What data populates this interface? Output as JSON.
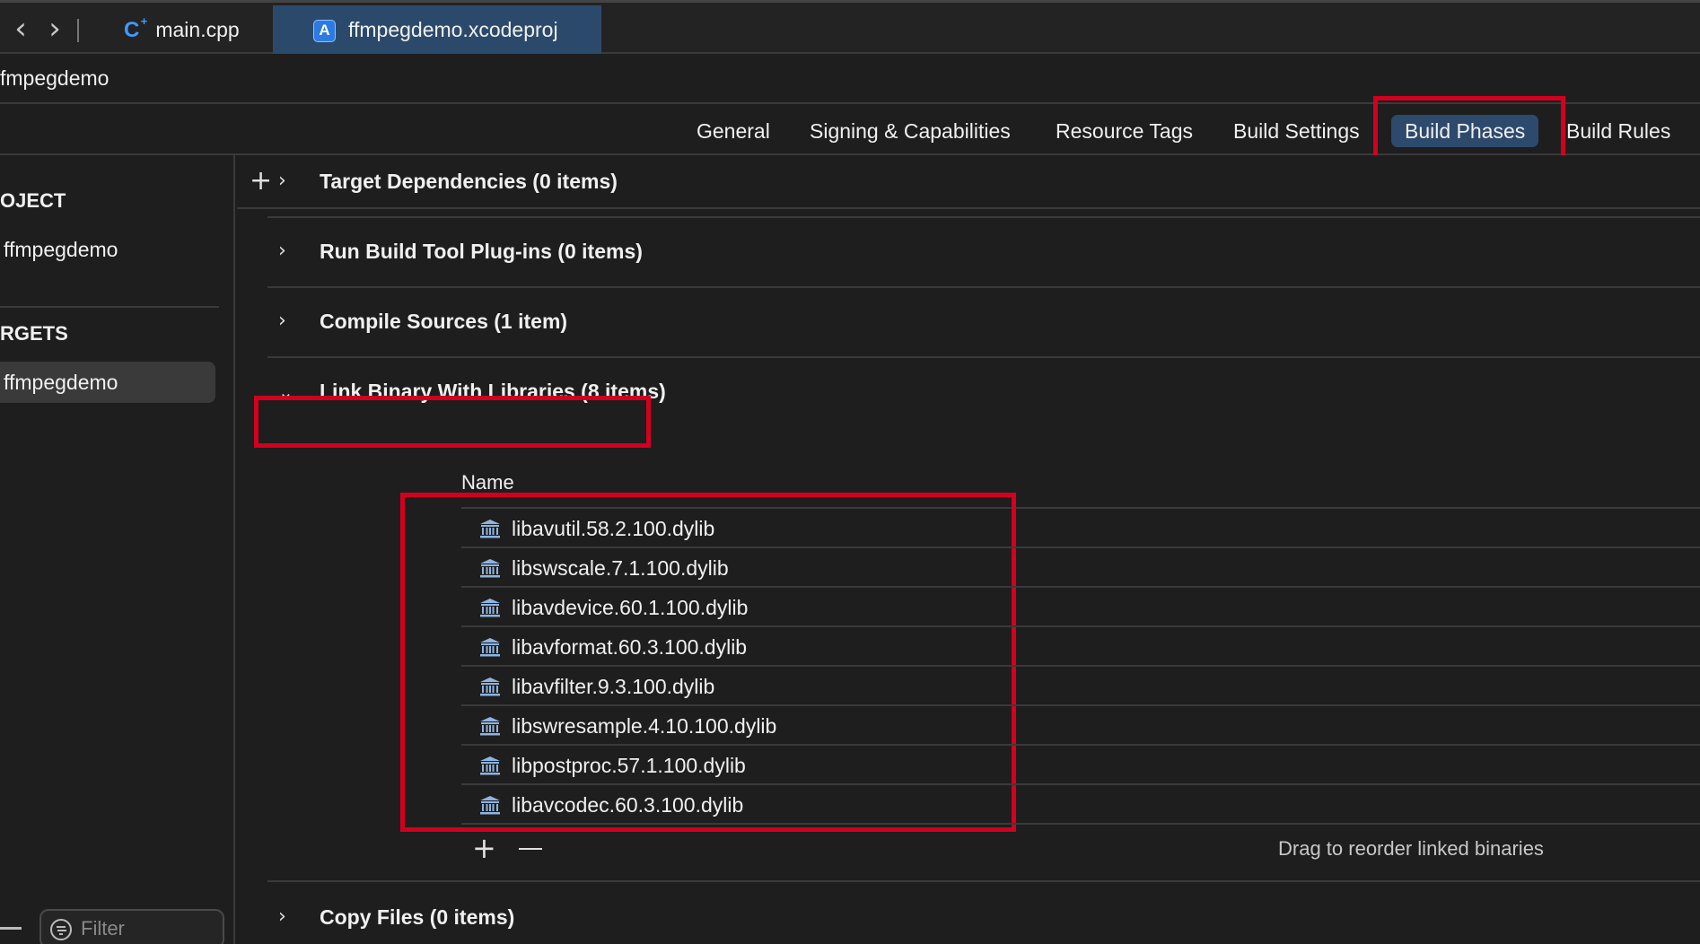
{
  "tabs": {
    "main_cpp": {
      "label": "main.cpp",
      "icon": "c-plus-plus-file-icon",
      "icon_text": "C",
      "icon_sup": "+"
    },
    "project": {
      "label": "ffmpegdemo.xcodeproj",
      "icon": "xcode-project-icon"
    }
  },
  "breadcrumb": {
    "label": "fmpegdemo"
  },
  "editor_tabs": {
    "general": "General",
    "signing": "Signing & Capabilities",
    "resource_tags": "Resource Tags",
    "build_settings": "Build Settings",
    "build_phases": "Build Phases",
    "build_rules": "Build Rules",
    "selected": "Build Phases"
  },
  "sidebar": {
    "project_header": "OJECT",
    "project_item": "ffmpegdemo",
    "targets_header": "RGETS",
    "target_item": "ffmpegdemo",
    "filter_placeholder": "Filter"
  },
  "phases": {
    "add_symbol": "+",
    "target_dependencies": "Target Dependencies (0 items)",
    "run_build_tool": "Run Build Tool Plug-ins (0 items)",
    "compile_sources": "Compile Sources (1 item)",
    "link_binary": "Link Binary With Libraries (8 items)",
    "copy_files": "Copy Files (0 items)"
  },
  "libraries": {
    "column_name": "Name",
    "items": [
      "libavutil.58.2.100.dylib",
      "libswscale.7.1.100.dylib",
      "libavdevice.60.1.100.dylib",
      "libavformat.60.3.100.dylib",
      "libavfilter.9.3.100.dylib",
      "libswresample.4.10.100.dylib",
      "libpostproc.57.1.100.dylib",
      "libavcodec.60.3.100.dylib"
    ],
    "add_symbol": "+",
    "drag_note": "Drag to reorder linked binaries"
  },
  "colors": {
    "background": "#1e1e1e",
    "selected_tab": "#2d4a6d",
    "highlight_box": "#d2001e",
    "cpp_icon": "#3d9bff",
    "library_icon": "#8fb4e0"
  }
}
